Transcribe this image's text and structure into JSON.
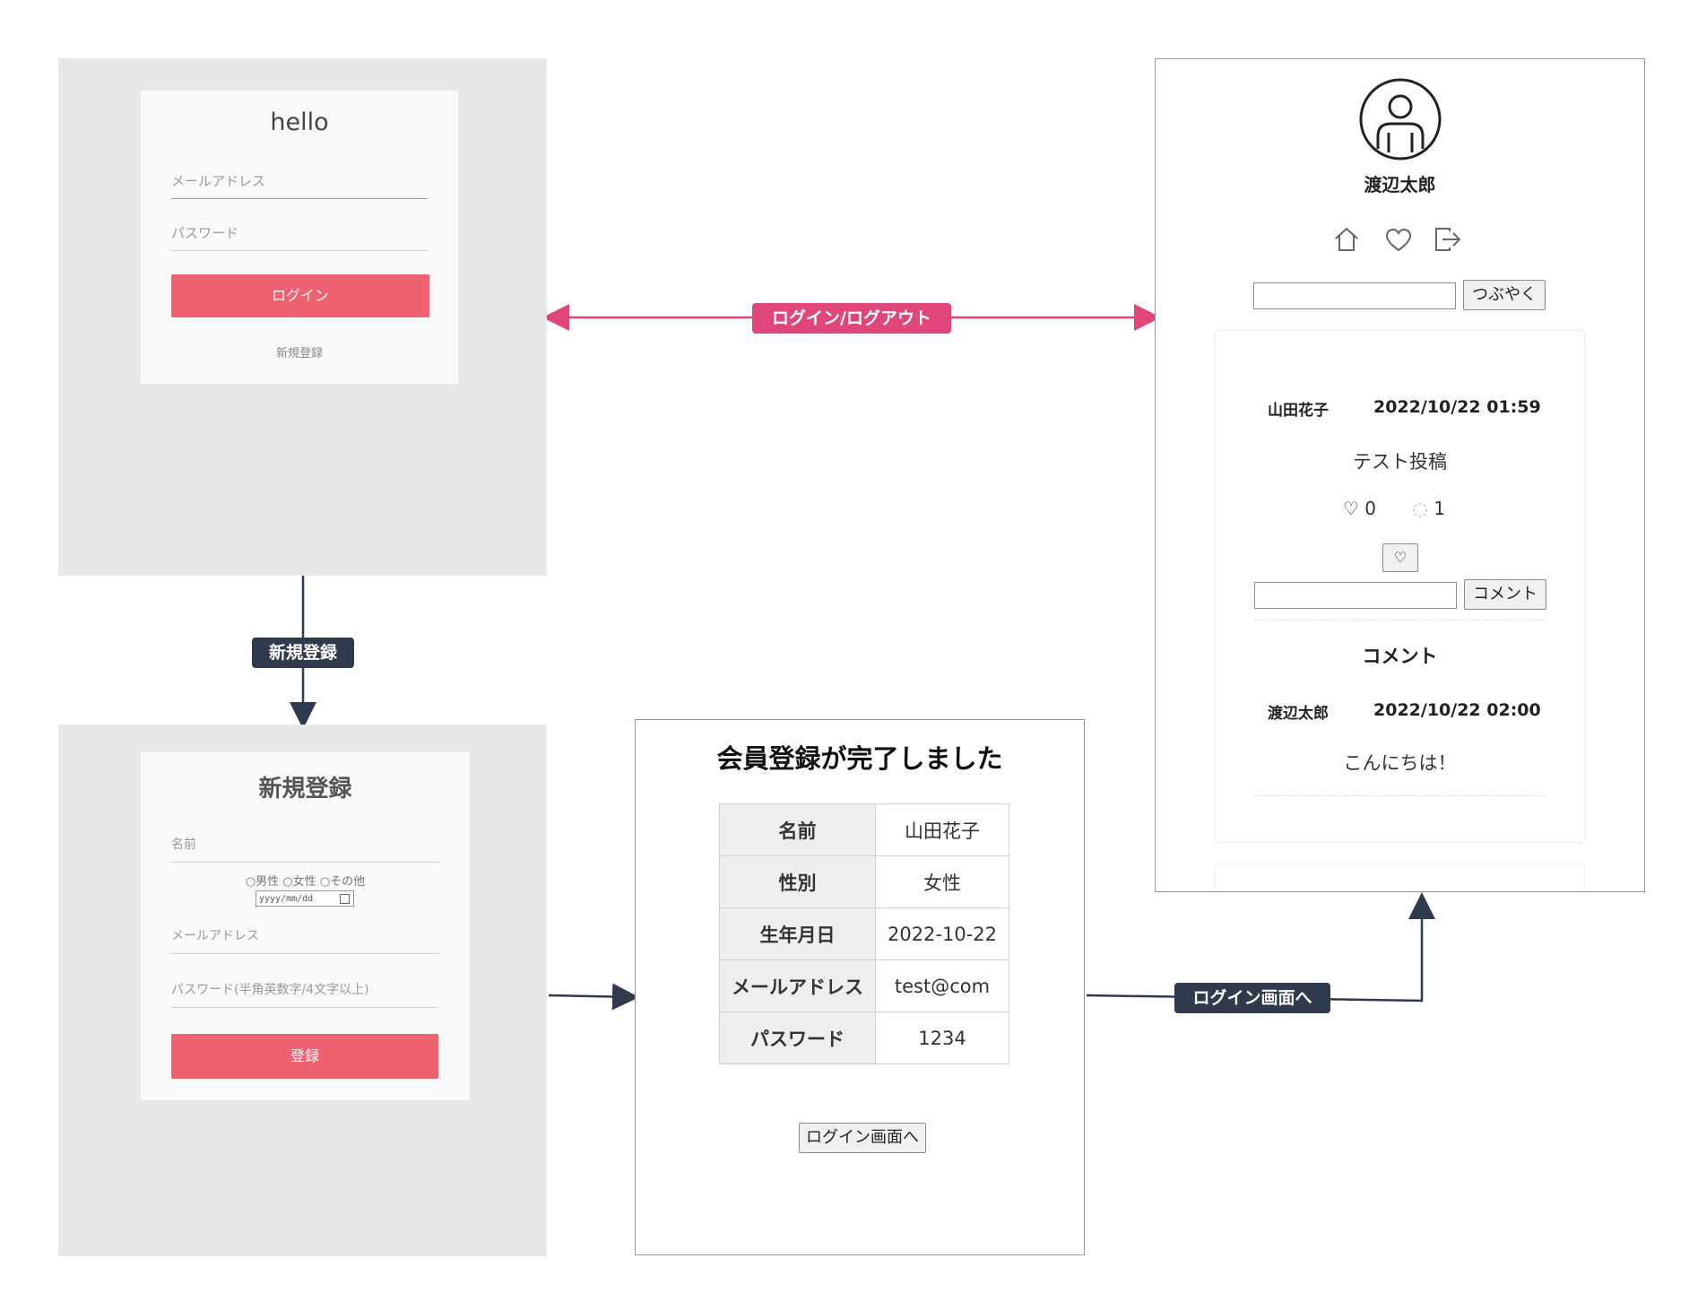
{
  "login_screen": {
    "title": "hello",
    "email_placeholder": "メールアドレス",
    "password_placeholder": "パスワード",
    "login_button": "ログイン",
    "register_link": "新規登録"
  },
  "register_screen": {
    "title": "新規登録",
    "name_placeholder": "名前",
    "gender_options": [
      "男性",
      "女性",
      "その他"
    ],
    "date_placeholder": "yyyy/mm/dd",
    "email_placeholder": "メールアドレス",
    "password_placeholder": "パスワード(半角英数字/4文字以上)",
    "register_button": "登録"
  },
  "complete_screen": {
    "title": "会員登録が完了しました",
    "rows": [
      {
        "label": "名前",
        "value": "山田花子"
      },
      {
        "label": "性別",
        "value": "女性"
      },
      {
        "label": "生年月日",
        "value": "2022-10-22"
      },
      {
        "label": "メールアドレス",
        "value": "test@com"
      },
      {
        "label": "パスワード",
        "value": "1234"
      }
    ],
    "login_button": "ログイン画面へ"
  },
  "timeline_screen": {
    "user_name": "渡辺太郎",
    "post_button": "つぶやく",
    "post": {
      "author": "山田花子",
      "datetime": "2022/10/22 01:59",
      "content": "テスト投稿",
      "likes": "0",
      "comments": "1"
    },
    "comment_button": "コメント",
    "comments_heading": "コメント",
    "comment": {
      "author": "渡辺太郎",
      "datetime": "2022/10/22 02:00",
      "content": "こんにちは！"
    }
  },
  "edges": {
    "login_logout": "ログイン/ログアウト",
    "register": "新規登録",
    "to_login": "ログイン画面へ"
  },
  "colors": {
    "accent_pink": "#ef6270",
    "edge_pink": "#e0457b",
    "edge_dark": "#2f3b4c",
    "panel_gray": "#e8e8e8"
  }
}
